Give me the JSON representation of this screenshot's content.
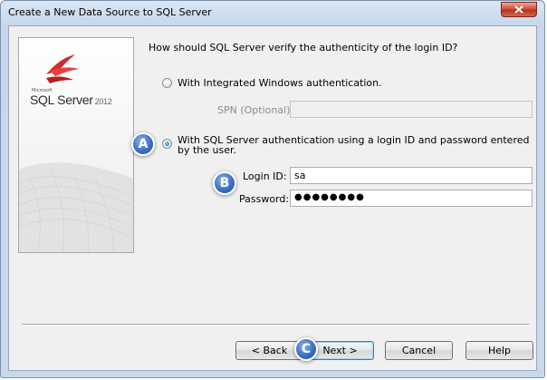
{
  "window": {
    "title": "Create a New Data Source to SQL Server"
  },
  "logo": {
    "microsoft": "Microsoft",
    "product": "SQL Server",
    "year": "2012"
  },
  "question": "How should SQL Server verify the authenticity of the login ID?",
  "options": {
    "integrated": {
      "label": "With Integrated Windows authentication.",
      "selected": false
    },
    "sql": {
      "label": "With SQL Server authentication using a login ID and password entered by the user.",
      "selected": true
    }
  },
  "spn": {
    "label": "SPN (Optional):",
    "value": ""
  },
  "login": {
    "label": "Login ID:",
    "value": "sa"
  },
  "password": {
    "label": "Password:",
    "value": "●●●●●●●●"
  },
  "buttons": {
    "back": "< Back",
    "next": "Next >",
    "cancel": "Cancel",
    "help": "Help"
  },
  "callouts": {
    "a": "A",
    "b": "B",
    "c": "C"
  },
  "colors": {
    "callout": "#3b6fc2",
    "close_button": "#c7432a"
  }
}
